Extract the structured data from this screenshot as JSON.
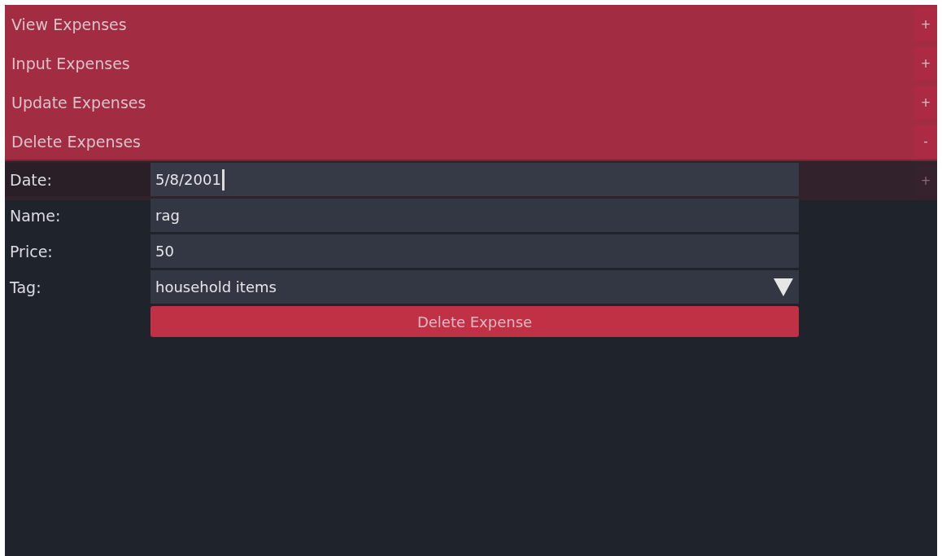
{
  "sections": [
    {
      "label": "View Expenses",
      "toggle": "+",
      "expanded": false
    },
    {
      "label": "Input Expenses",
      "toggle": "+",
      "expanded": false
    },
    {
      "label": "Update Expenses",
      "toggle": "+",
      "expanded": false
    },
    {
      "label": "Delete Expenses",
      "toggle": "-",
      "expanded": true
    }
  ],
  "covered_header": {
    "toggle": "+"
  },
  "form": {
    "fields": [
      {
        "label": "Date:",
        "kind": "text",
        "value": "5/8/2001",
        "focused": true
      },
      {
        "label": "Name:",
        "kind": "text",
        "value": "rag",
        "focused": false
      },
      {
        "label": "Price:",
        "kind": "text",
        "value": "50",
        "focused": false
      },
      {
        "label": "Tag:",
        "kind": "dropdown",
        "value": "household items",
        "focused": false
      }
    ],
    "button": "Delete Expense"
  }
}
